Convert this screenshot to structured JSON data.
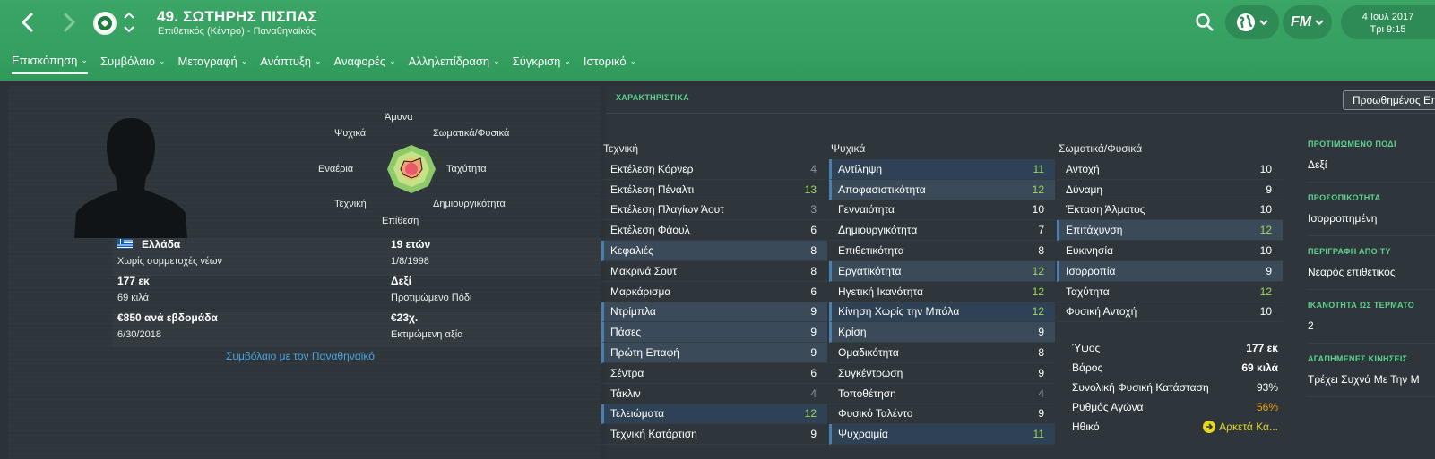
{
  "header": {
    "player_title": "49. ΣΩΤΗΡΗΣ ΠΙΣΠΑΣ",
    "player_subtitle": "Επιθετικός (Κέντρο) - Παναθηναϊκός",
    "date_line1": "4 Ιουλ 2017",
    "date_line2": "Τρι 9:15",
    "fm_label": "FM"
  },
  "tabs": [
    {
      "label": "Επισκόπηση"
    },
    {
      "label": "Συμβόλαιο"
    },
    {
      "label": "Μεταγραφή"
    },
    {
      "label": "Ανάπτυξη"
    },
    {
      "label": "Αναφορές"
    },
    {
      "label": "Αλληλεπίδραση"
    },
    {
      "label": "Σύγκριση"
    },
    {
      "label": "Ιστορικό"
    }
  ],
  "radar": {
    "labels": {
      "top": "Άμυνα",
      "top_right": "Σωματικά/Φυσικά",
      "right": "Ταχύτητα",
      "bottom_right": "Δημιουργικότητα",
      "bottom": "Επίθεση",
      "bottom_left": "Τεχνική",
      "left": "Εναέρια",
      "top_left": "Ψυχικά"
    }
  },
  "info": {
    "nationality": "Ελλάδα",
    "youth_caps": "Χωρίς συμμετοχές νέων",
    "age": "19 ετών",
    "dob": "1/8/1998",
    "height": "177 εκ",
    "weight": "69 κιλά",
    "foot": "Δεξί",
    "foot_label": "Προτιμώμενο Πόδι",
    "wage": "€850 ανά εβδομάδα",
    "contract_end": "6/30/2018",
    "value": "€23χ.",
    "value_label": "Εκτιμώμενη αξία",
    "contract_link": "Συμβόλαιο με τον Παναθηναϊκό"
  },
  "attributes": {
    "section_title": "ΧΑΡΑΚΤΗΡΙΣΤΙΚΑ",
    "advanced_button": "Προωθημένος Επ",
    "technical_title": "Τεχνική",
    "mental_title": "Ψυχικά",
    "physical_title": "Σωματικά/Φυσικά",
    "technical": [
      {
        "name": "Εκτέλεση Κόρνερ",
        "value": "4"
      },
      {
        "name": "Εκτέλεση Πέναλτι",
        "value": "13"
      },
      {
        "name": "Εκτέλεση Πλαγίων Άουτ",
        "value": "3"
      },
      {
        "name": "Εκτέλεση Φάουλ",
        "value": "6"
      },
      {
        "name": "Κεφαλιές",
        "value": "8"
      },
      {
        "name": "Μακρινά Σουτ",
        "value": "8"
      },
      {
        "name": "Μαρκάρισμα",
        "value": "6"
      },
      {
        "name": "Ντρίμπλα",
        "value": "9"
      },
      {
        "name": "Πάσες",
        "value": "9"
      },
      {
        "name": "Πρώτη Επαφή",
        "value": "9"
      },
      {
        "name": "Σέντρα",
        "value": "6"
      },
      {
        "name": "Τάκλιν",
        "value": "4"
      },
      {
        "name": "Τελειώματα",
        "value": "12"
      },
      {
        "name": "Τεχνική Κατάρτιση",
        "value": "9"
      }
    ],
    "mental": [
      {
        "name": "Αντίληψη",
        "value": "11"
      },
      {
        "name": "Αποφασιστικότητα",
        "value": "12"
      },
      {
        "name": "Γενναιότητα",
        "value": "10"
      },
      {
        "name": "Δημιουργικότητα",
        "value": "7"
      },
      {
        "name": "Επιθετικότητα",
        "value": "8"
      },
      {
        "name": "Εργατικότητα",
        "value": "12"
      },
      {
        "name": "Ηγετική Ικανότητα",
        "value": "12"
      },
      {
        "name": "Κίνηση Χωρίς την Μπάλα",
        "value": "12"
      },
      {
        "name": "Κρίση",
        "value": "9"
      },
      {
        "name": "Ομαδικότητα",
        "value": "8"
      },
      {
        "name": "Συγκέντρωση",
        "value": "9"
      },
      {
        "name": "Τοποθέτηση",
        "value": "4"
      },
      {
        "name": "Φυσικό Ταλέντο",
        "value": "9"
      },
      {
        "name": "Ψυχραιμία",
        "value": "11"
      }
    ],
    "physical": [
      {
        "name": "Αντοχή",
        "value": "10"
      },
      {
        "name": "Δύναμη",
        "value": "9"
      },
      {
        "name": "Έκταση Άλματος",
        "value": "10"
      },
      {
        "name": "Επιτάχυνση",
        "value": "12"
      },
      {
        "name": "Ευκινησία",
        "value": "10"
      },
      {
        "name": "Ισορροπία",
        "value": "9"
      },
      {
        "name": "Ταχύτητα",
        "value": "12"
      },
      {
        "name": "Φυσική Αντοχή",
        "value": "10"
      }
    ],
    "physical_extra": [
      {
        "name": "Ύψος",
        "value": "177 εκ"
      },
      {
        "name": "Βάρος",
        "value": "69 κιλά"
      },
      {
        "name": "Συνολική Φυσική Κατάσταση",
        "value": "93%"
      },
      {
        "name": "Ρυθμός Αγώνα",
        "value": "56%"
      },
      {
        "name": "Ηθικό",
        "value": "Αρκετά Κα..."
      }
    ]
  },
  "side": [
    {
      "heading": "ΠΡΟΤΙΜΩΜΕΝΟ ΠΟΔΙ",
      "value": "Δεξί"
    },
    {
      "heading": "ΠΡΟΣΩΠΙΚΟΤΗΤΑ",
      "value": "Ισορροπημένη"
    },
    {
      "heading": "ΠΕΡΙΓΡΑΦΗ ΑΠΟ ΤΥ",
      "value": "Νεαρός επιθετικός"
    },
    {
      "heading": "ΙΚΑΝΟΤΗΤΑ ΩΣ ΤΕΡΜΑΤΟ",
      "value": "2"
    },
    {
      "heading": "ΑΓΑΠΗΜΕΝΕΣ ΚΙΝΗΣΕΙΣ",
      "value": "Τρέχει Συχνά Με Την Μ"
    }
  ],
  "colors": {
    "header_green": "#35a061",
    "panel_bg": "#2e363b",
    "accent_green": "#5fd08d",
    "value_green": "#9fd75a",
    "link_blue": "#4aa3df",
    "fitness_orange": "#f0a020",
    "morale_yellow": "#e5d920"
  }
}
